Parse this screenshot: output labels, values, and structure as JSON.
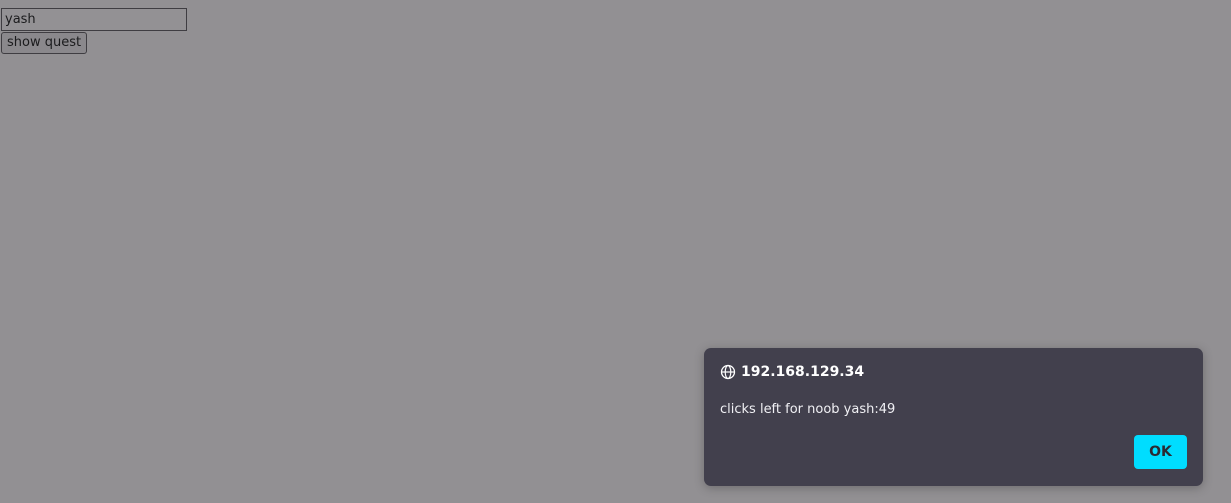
{
  "form": {
    "name_value": "yash",
    "show_button_label": "show quest"
  },
  "dialog": {
    "origin": "192.168.129.34",
    "message": "clicks left for noob yash:49",
    "ok_label": "OK"
  },
  "colors": {
    "page_background": "#929093",
    "dialog_background": "#42404d",
    "accent": "#00ddff"
  },
  "icons": {
    "dialog_origin_icon": "globe-icon"
  }
}
